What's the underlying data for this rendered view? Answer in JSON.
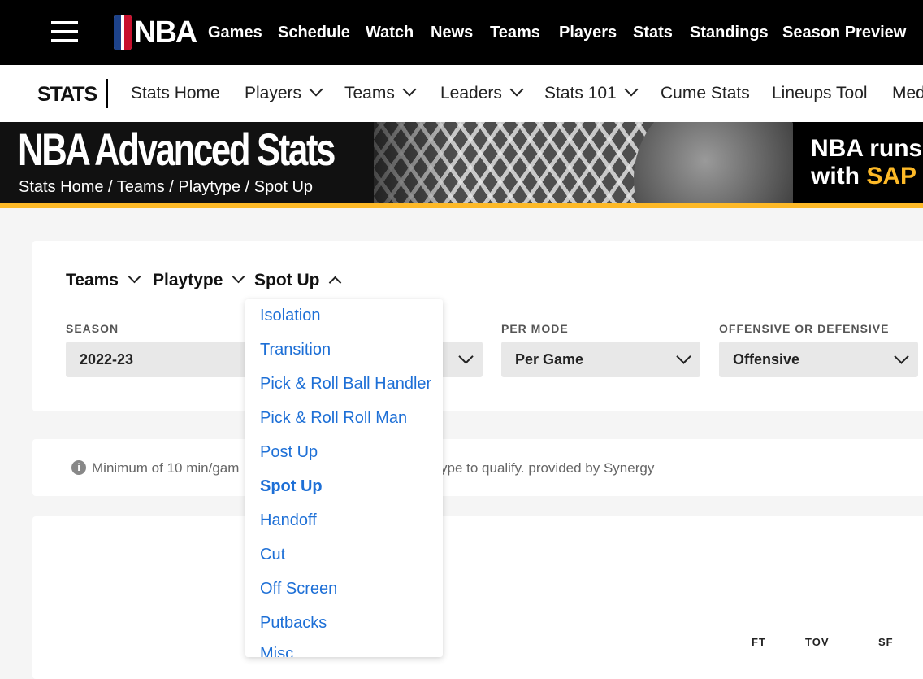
{
  "topnav": {
    "logo_text": "NBA",
    "links": [
      "Games",
      "Schedule",
      "Watch",
      "News",
      "Teams",
      "Players",
      "Stats",
      "Standings",
      "Season Preview"
    ]
  },
  "subnav": {
    "section_label": "STATS",
    "links": [
      "Stats Home",
      "Players",
      "Teams",
      "Leaders",
      "Stats 101",
      "Cume Stats",
      "Lineups Tool",
      "Med"
    ]
  },
  "banner": {
    "title": "NBA Advanced Stats",
    "breadcrumb": "Stats Home / Teams / Playtype / Spot Up",
    "sap_line1": "NBA runs",
    "sap_line2_prefix": "with ",
    "sap_line2_highlight": "SAP"
  },
  "selectors": {
    "category": "Teams",
    "playtype": "Playtype",
    "current": "Spot Up"
  },
  "filters": {
    "season_label": "SEASON",
    "season_value": "2022-23",
    "per_mode_label": "PER MODE",
    "per_mode_value": "Per Game",
    "off_def_label": "OFFENSIVE OR DEFENSIVE",
    "off_def_value": "Offensive"
  },
  "info": {
    "left_text": "Minimum of 10 min/gam",
    "right_text": "ype to qualify. provided by Synergy"
  },
  "table_headers": [
    "FT",
    "TOV",
    "SF"
  ],
  "dropdown": {
    "options": [
      "Isolation",
      "Transition",
      "Pick & Roll Ball Handler",
      "Pick & Roll Roll Man",
      "Post Up",
      "Spot Up",
      "Handoff",
      "Cut",
      "Off Screen",
      "Putbacks",
      "Misc"
    ],
    "selected": "Spot Up"
  },
  "colors": {
    "accent_gold": "#fdb927",
    "link_blue": "#1d6fd6"
  }
}
